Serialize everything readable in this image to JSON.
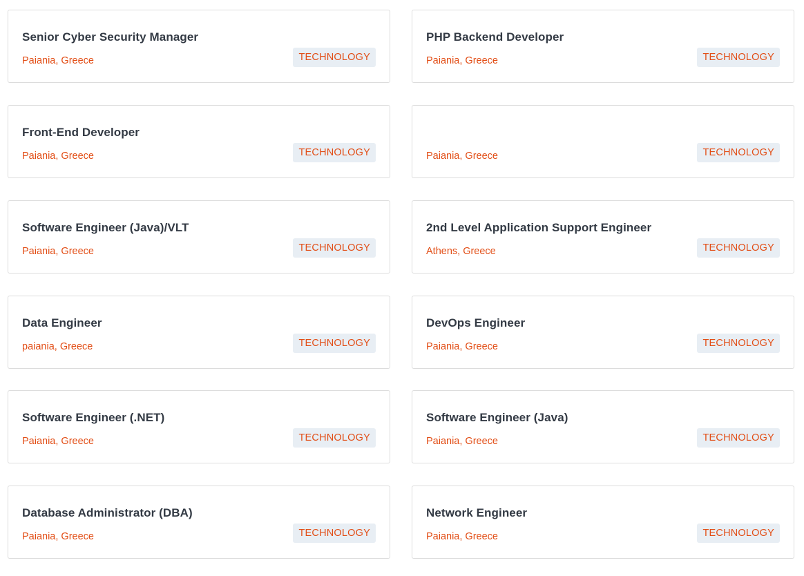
{
  "jobs": [
    {
      "title": "Senior Cyber Security Manager",
      "location": "Paiania, Greece",
      "category": "TECHNOLOGY"
    },
    {
      "title": "PHP Backend Developer",
      "location": "Paiania, Greece",
      "category": "TECHNOLOGY"
    },
    {
      "title": "Front-End Developer",
      "location": "Paiania, Greece",
      "category": "TECHNOLOGY"
    },
    {
      "title": "",
      "location": "Paiania, Greece",
      "category": "TECHNOLOGY"
    },
    {
      "title": "Software Engineer (Java)/VLT",
      "location": "Paiania, Greece",
      "category": "TECHNOLOGY"
    },
    {
      "title": "2nd Level Application Support Engineer",
      "location": "Athens, Greece",
      "category": "TECHNOLOGY"
    },
    {
      "title": "Data Engineer",
      "location": "paiania, Greece",
      "category": "TECHNOLOGY"
    },
    {
      "title": "DevOps Engineer",
      "location": "Paiania, Greece",
      "category": "TECHNOLOGY"
    },
    {
      "title": "Software Engineer (.NET)",
      "location": "Paiania, Greece",
      "category": "TECHNOLOGY"
    },
    {
      "title": "Software Engineer (Java)",
      "location": "Paiania, Greece",
      "category": "TECHNOLOGY"
    },
    {
      "title": "Database Administrator (DBA)",
      "location": "Paiania, Greece",
      "category": "TECHNOLOGY"
    },
    {
      "title": "Network Engineer",
      "location": "Paiania, Greece",
      "category": "TECHNOLOGY"
    }
  ],
  "colors": {
    "accent": "#e24d15",
    "title_text": "#333a44",
    "tag_background": "#e8eef4",
    "card_border": "#dcdcdc"
  }
}
